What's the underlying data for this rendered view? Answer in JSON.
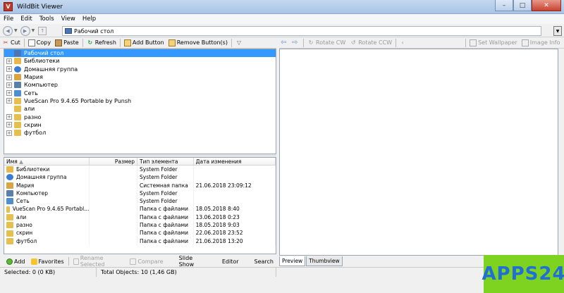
{
  "window": {
    "title": "WildBit Viewer",
    "icon_letter": "V"
  },
  "menu": [
    "File",
    "Edit",
    "Tools",
    "View",
    "Help"
  ],
  "address": {
    "path": "Рабочий стол"
  },
  "toolbar": {
    "cut": "Cut",
    "copy": "Copy",
    "paste": "Paste",
    "refresh": "Refresh",
    "add_button": "Add Button",
    "remove_buttons": "Remove Button(s)"
  },
  "preview_toolbar": {
    "rotate_cw": "Rotate CW",
    "rotate_ccw": "Rotate CCW",
    "set_wallpaper": "Set Wallpaper",
    "image_info": "Image Info"
  },
  "tree": [
    {
      "label": "Рабочий стол",
      "expander": "",
      "selected": true,
      "color": "#4d76b0"
    },
    {
      "label": "Библиотеки",
      "expander": "+",
      "color": "#e8b84a"
    },
    {
      "label": "Домашняя группа",
      "expander": "+",
      "color": "#3a7bd5"
    },
    {
      "label": "Мария",
      "expander": "+",
      "color": "#d9a441"
    },
    {
      "label": "Компьютер",
      "expander": "+",
      "color": "#5a7fa8"
    },
    {
      "label": "Сеть",
      "expander": "+",
      "color": "#4f8fcf"
    },
    {
      "label": "VueScan Pro 9.4.65 Portable by Punsh",
      "expander": "+",
      "color": "#e6c04e"
    },
    {
      "label": "али",
      "expander": "",
      "color": "#e6c04e"
    },
    {
      "label": "разно",
      "expander": "+",
      "color": "#e6c04e"
    },
    {
      "label": "скрин",
      "expander": "+",
      "color": "#e6c04e"
    },
    {
      "label": "футбол",
      "expander": "+",
      "color": "#e6c04e"
    }
  ],
  "list": {
    "columns": {
      "name": "Имя",
      "size": "Размер",
      "type": "Тип элемента",
      "date": "Дата изменения"
    },
    "rows": [
      {
        "name": "Библиотеки",
        "size": "",
        "type": "System Folder",
        "date": "",
        "color": "#e8b84a"
      },
      {
        "name": "Домашняя группа",
        "size": "",
        "type": "System Folder",
        "date": "",
        "color": "#3a7bd5"
      },
      {
        "name": "Мария",
        "size": "",
        "type": "Системная папка",
        "date": "21.06.2018 23:09:12",
        "color": "#d9a441"
      },
      {
        "name": "Компьютер",
        "size": "",
        "type": "System Folder",
        "date": "",
        "color": "#5a7fa8"
      },
      {
        "name": "Сеть",
        "size": "",
        "type": "System Folder",
        "date": "",
        "color": "#4f8fcf"
      },
      {
        "name": "VueScan Pro 9.4.65 Portabl...",
        "size": "",
        "type": "Папка с файлами",
        "date": "18.05.2018 8:40",
        "color": "#e6c04e"
      },
      {
        "name": "али",
        "size": "",
        "type": "Папка с файлами",
        "date": "13.06.2018 0:23",
        "color": "#e6c04e"
      },
      {
        "name": "разно",
        "size": "",
        "type": "Папка с файлами",
        "date": "18.05.2018 9:03",
        "color": "#e6c04e"
      },
      {
        "name": "скрин",
        "size": "",
        "type": "Папка с файлами",
        "date": "22.06.2018 23:52",
        "color": "#e6c04e"
      },
      {
        "name": "футбол",
        "size": "",
        "type": "Папка с файлами",
        "date": "21.06.2018 13:20",
        "color": "#e6c04e"
      }
    ]
  },
  "bottom_bar": {
    "add": "Add",
    "favorites": "Favorites",
    "rename": "Rename Selected",
    "compare": "Compare",
    "slideshow": "Slide Show",
    "editor": "Editor",
    "search": "Search"
  },
  "preview_tabs": {
    "preview": "Preview",
    "thumbview": "Thumbview"
  },
  "status": {
    "selected": "Selected: 0 (0 KB)",
    "total": "Total Objects: 10 (1,46 GB)"
  },
  "watermark": {
    "text": "APPS24"
  }
}
